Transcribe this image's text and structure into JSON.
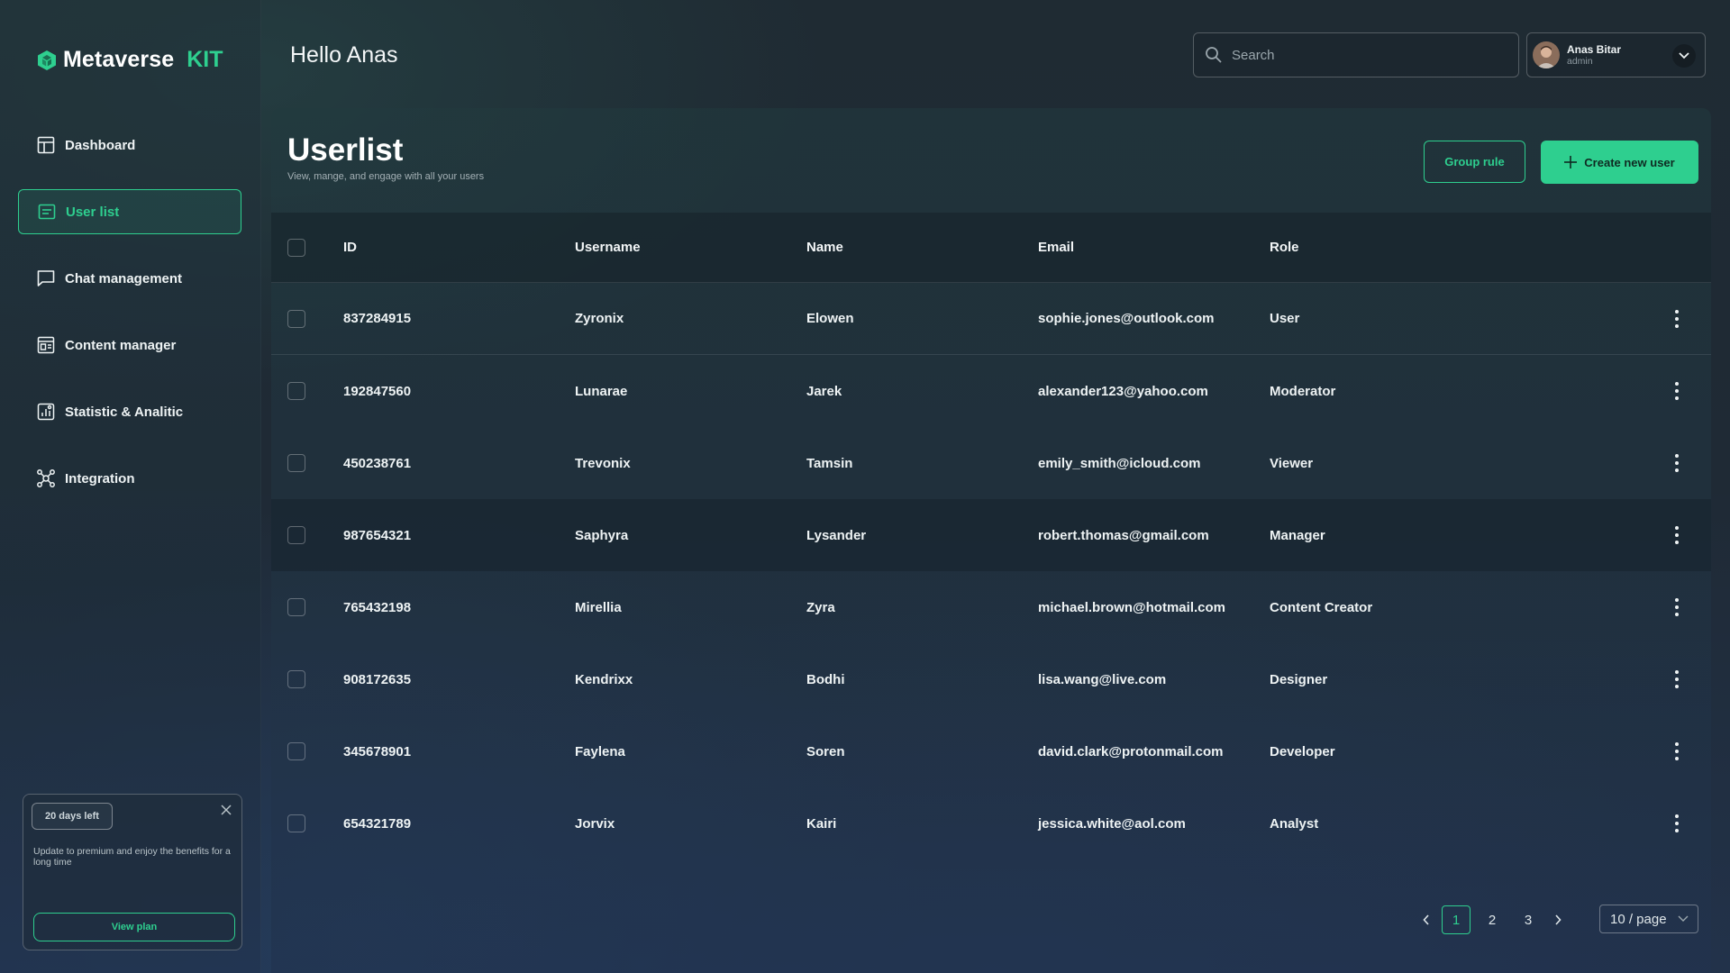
{
  "brand": {
    "name": "Metaverse",
    "suffix": "KIT",
    "accent": "#2ecf8f"
  },
  "sidebar": {
    "items": [
      {
        "label": "Dashboard",
        "icon": "dashboard-icon",
        "active": false
      },
      {
        "label": "User list",
        "icon": "user-list-icon",
        "active": true
      },
      {
        "label": "Chat management",
        "icon": "chat-icon",
        "active": false
      },
      {
        "label": "Content manager",
        "icon": "content-icon",
        "active": false
      },
      {
        "label": "Statistic & Analitic",
        "icon": "chart-icon",
        "active": false
      },
      {
        "label": "Integration",
        "icon": "integration-icon",
        "active": false
      }
    ],
    "promo": {
      "badge": "20 days left",
      "text": "Update to premium and enjoy the benefits for a long time",
      "button": "View plan"
    }
  },
  "header": {
    "greeting": "Hello Anas",
    "search_placeholder": "Search",
    "user": {
      "name": "Anas Bitar",
      "role": "admin"
    }
  },
  "main": {
    "title": "Userlist",
    "subtitle": "View, mange, and engage with all your users",
    "group_rule_label": "Group rule",
    "create_label": "Create new user"
  },
  "table": {
    "columns": [
      "ID",
      "Username",
      "Name",
      "Email",
      "Role"
    ],
    "rows": [
      {
        "id": "837284915",
        "username": "Zyronix",
        "name": "Elowen",
        "email": "sophie.jones@outlook.com",
        "role": "User"
      },
      {
        "id": "192847560",
        "username": "Lunarae",
        "name": "Jarek",
        "email": "alexander123@yahoo.com",
        "role": "Moderator"
      },
      {
        "id": "450238761",
        "username": "Trevonix",
        "name": "Tamsin",
        "email": "emily_smith@icloud.com",
        "role": "Viewer"
      },
      {
        "id": "987654321",
        "username": "Saphyra",
        "name": "Lysander",
        "email": "robert.thomas@gmail.com",
        "role": "Manager"
      },
      {
        "id": "765432198",
        "username": "Mirellia",
        "name": "Zyra",
        "email": "michael.brown@hotmail.com",
        "role": "Content Creator"
      },
      {
        "id": "908172635",
        "username": "Kendrixx",
        "name": "Bodhi",
        "email": "lisa.wang@live.com",
        "role": "Designer"
      },
      {
        "id": "345678901",
        "username": "Faylena",
        "name": "Soren",
        "email": "david.clark@protonmail.com",
        "role": "Developer"
      },
      {
        "id": "654321789",
        "username": "Jorvix",
        "name": "Kairi",
        "email": "jessica.white@aol.com",
        "role": "Analyst"
      }
    ]
  },
  "pagination": {
    "pages": [
      "1",
      "2",
      "3"
    ],
    "current": "1",
    "per_page": "10 / page"
  }
}
